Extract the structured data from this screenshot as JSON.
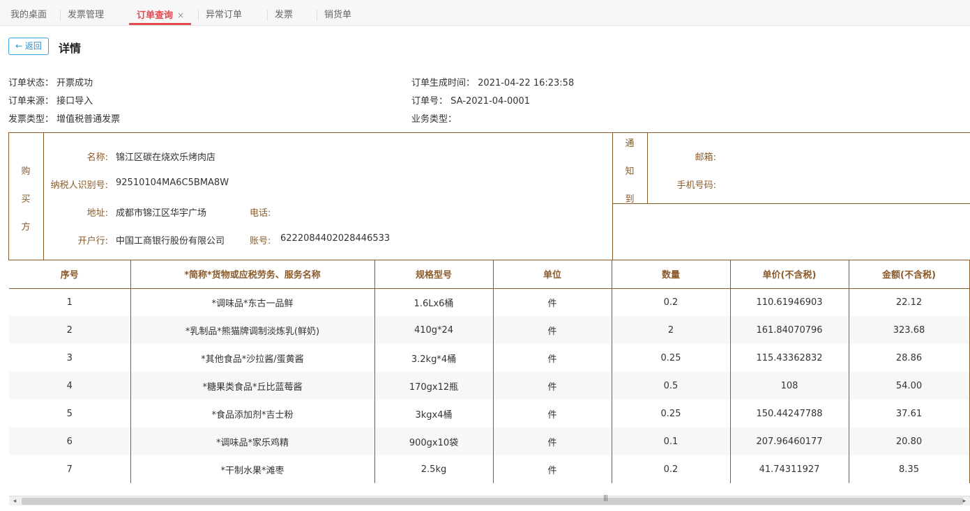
{
  "tabs": [
    {
      "label": "我的桌面"
    },
    {
      "label": "发票管理"
    },
    {
      "label": "订单查询",
      "close": "×"
    },
    {
      "label": "异常订单"
    },
    {
      "label": "发票"
    },
    {
      "label": "销货单"
    }
  ],
  "header": {
    "back_label": "← 返回",
    "title": "详情"
  },
  "order": {
    "status_label": "订单状态：",
    "status_value": "开票成功",
    "created_label": "订单生成时间：",
    "created_value": "2021-04-22 16:23:58",
    "source_label": "订单来源：",
    "source_value": "接口导入",
    "order_no_label": "订单号：",
    "order_no_value": "SA-2021-04-0001",
    "invoice_type_label": "发票类型：",
    "invoice_type_value": "增值税普通发票",
    "biz_type_label": "业务类型：",
    "biz_type_value": ""
  },
  "buyer": {
    "side_chars": [
      "购",
      "买",
      "方"
    ],
    "name_label": "名称:",
    "name_value": "锦江区碳在烧欢乐烤肉店",
    "tax_label": "纳税人识别号:",
    "tax_value": "92510104MA6C5BMA8W",
    "address_label": "地址:",
    "address_value": "成都市锦江区华宇广场",
    "phone_label": "电话:",
    "phone_value": "",
    "bank_label": "开户行:",
    "bank_value": "中国工商银行股份有限公司",
    "account_label": "账号:",
    "account_value": "6222084402028446533"
  },
  "notify": {
    "side_chars": [
      "通",
      "知",
      "到"
    ],
    "email_label": "邮箱:",
    "email_value": "",
    "mobile_label": "手机号码:",
    "mobile_value": ""
  },
  "items": {
    "columns": [
      "序号",
      "*简称*货物或应税劳务、服务名称",
      "规格型号",
      "单位",
      "数量",
      "单价(不含税)",
      "金额(不含税)"
    ],
    "rows": [
      [
        "1",
        "*调味品*东古一品鲜",
        "1.6Lx6桶",
        "件",
        "0.2",
        "110.61946903",
        "22.12"
      ],
      [
        "2",
        "*乳制品*熊猫牌调制淡炼乳(鲜奶)",
        "410g*24",
        "件",
        "2",
        "161.84070796",
        "323.68"
      ],
      [
        "3",
        "*其他食品*沙拉酱/蛋黄酱",
        "3.2kg*4桶",
        "件",
        "0.25",
        "115.43362832",
        "28.86"
      ],
      [
        "4",
        "*糖果类食品*丘比蓝莓酱",
        "170gx12瓶",
        "件",
        "0.5",
        "108",
        "54.00"
      ],
      [
        "5",
        "*食品添加剂*吉士粉",
        "3kgx4桶",
        "件",
        "0.25",
        "150.44247788",
        "37.61"
      ],
      [
        "6",
        "*调味品*家乐鸡精",
        "900gx10袋",
        "件",
        "0.1",
        "207.96460177",
        "20.80"
      ],
      [
        "7",
        "*干制水果*滩枣",
        "2.5kg",
        "件",
        "0.2",
        "41.74311927",
        "8.35"
      ]
    ]
  },
  "scrollbar": {
    "left": "◂",
    "right": "▸",
    "grip": "|||"
  }
}
